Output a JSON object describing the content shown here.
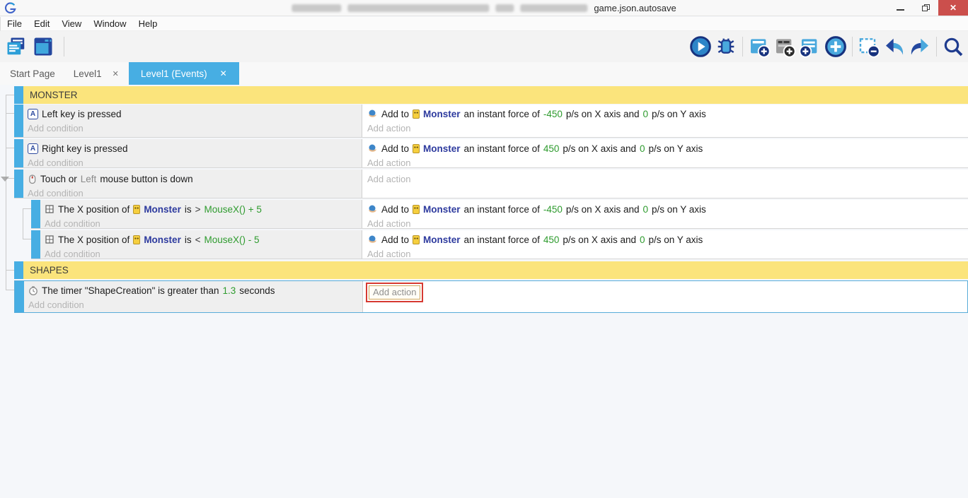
{
  "colors": {
    "accent_blue": "#47aee3",
    "group_yellow": "#fbe47c",
    "value_green": "#2e9b2e",
    "object_blue": "#2d3a9e",
    "close_red": "#cb4f4c"
  },
  "window": {
    "title_visible": "game.json.autosave",
    "close_glyph": "✕"
  },
  "menu": {
    "file": "File",
    "edit": "Edit",
    "view": "View",
    "window": "Window",
    "help": "Help"
  },
  "toolbar": {
    "left_icons": [
      "project-manager",
      "scene-editor"
    ],
    "right_icons": [
      "preview-play",
      "debug-bug",
      "add-event",
      "add-comment",
      "add-subevent",
      "add-other-event",
      "delete-event",
      "undo",
      "redo",
      "search"
    ]
  },
  "tabs": {
    "start_page": "Start Page",
    "level1": "Level1",
    "level1_events": "Level1 (Events)",
    "close_glyph": "✕"
  },
  "icons": {
    "keyboard_letter": "A"
  },
  "labels": {
    "add_condition": "Add condition",
    "add_action": "Add action"
  },
  "groups": {
    "monster": "MONSTER",
    "shapes": "SHAPES"
  },
  "events": {
    "left_key": {
      "condition": "Left key is pressed"
    },
    "right_key": {
      "condition": "Right key is pressed"
    },
    "touch": {
      "part1": "Touch or",
      "param": "Left",
      "part2": "mouse button is down"
    },
    "x_gt": {
      "pre": "The X position of",
      "object": "Monster",
      "is": "is",
      "op": ">",
      "expr": "MouseX() + 5"
    },
    "x_lt": {
      "pre": "The X position of",
      "object": "Monster",
      "is": "is",
      "op": "<",
      "expr": "MouseX() - 5"
    },
    "timer": {
      "pre": "The timer \"ShapeCreation\" is greater than",
      "value": "1.3",
      "post": "seconds"
    },
    "actions": {
      "neg": {
        "add_to": "Add to",
        "object": "Monster",
        "t1": "an instant force of",
        "x": "-450",
        "t2": "p/s on X axis and",
        "y": "0",
        "t3": "p/s on Y axis"
      },
      "pos": {
        "add_to": "Add to",
        "object": "Monster",
        "t1": "an instant force of",
        "x": "450",
        "t2": "p/s on X axis and",
        "y": "0",
        "t3": "p/s on Y axis"
      }
    }
  }
}
